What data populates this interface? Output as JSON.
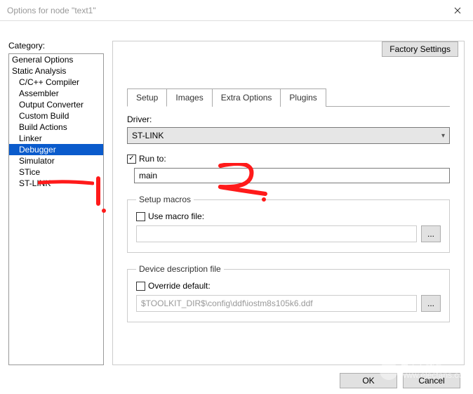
{
  "window": {
    "title": "Options for node \"text1\""
  },
  "category": {
    "label": "Category:",
    "items": [
      {
        "label": "General Options",
        "indent": false
      },
      {
        "label": "Static Analysis",
        "indent": false
      },
      {
        "label": "C/C++ Compiler",
        "indent": true
      },
      {
        "label": "Assembler",
        "indent": true
      },
      {
        "label": "Output Converter",
        "indent": true
      },
      {
        "label": "Custom Build",
        "indent": true
      },
      {
        "label": "Build Actions",
        "indent": true
      },
      {
        "label": "Linker",
        "indent": true
      },
      {
        "label": "Debugger",
        "indent": true,
        "selected": true
      },
      {
        "label": "Simulator",
        "indent": true
      },
      {
        "label": "STice",
        "indent": true
      },
      {
        "label": "ST-LINK",
        "indent": true
      }
    ]
  },
  "buttons": {
    "factory": "Factory Settings",
    "ok": "OK",
    "cancel": "Cancel",
    "browse": "..."
  },
  "tabs": {
    "items": [
      "Setup",
      "Images",
      "Extra Options",
      "Plugins"
    ],
    "active": 0
  },
  "setup": {
    "driver_label": "Driver:",
    "driver_value": "ST-LINK",
    "run_to_label": "Run to:",
    "run_to_checked": true,
    "run_to_value": "main",
    "macros_legend": "Setup macros",
    "use_macro_label": "Use macro file:",
    "use_macro_checked": false,
    "macro_file": "",
    "ddf_legend": "Device description file",
    "override_label": "Override default:",
    "override_checked": false,
    "ddf_path": "$TOOLKIT_DIR$\\config\\ddf\\iostm8s105k6.ddf"
  },
  "annotations": {
    "mark1": "1.",
    "mark2": "2."
  },
  "watermark": {
    "line1": "电子发烧友",
    "line2": "www.elecfans.com"
  }
}
